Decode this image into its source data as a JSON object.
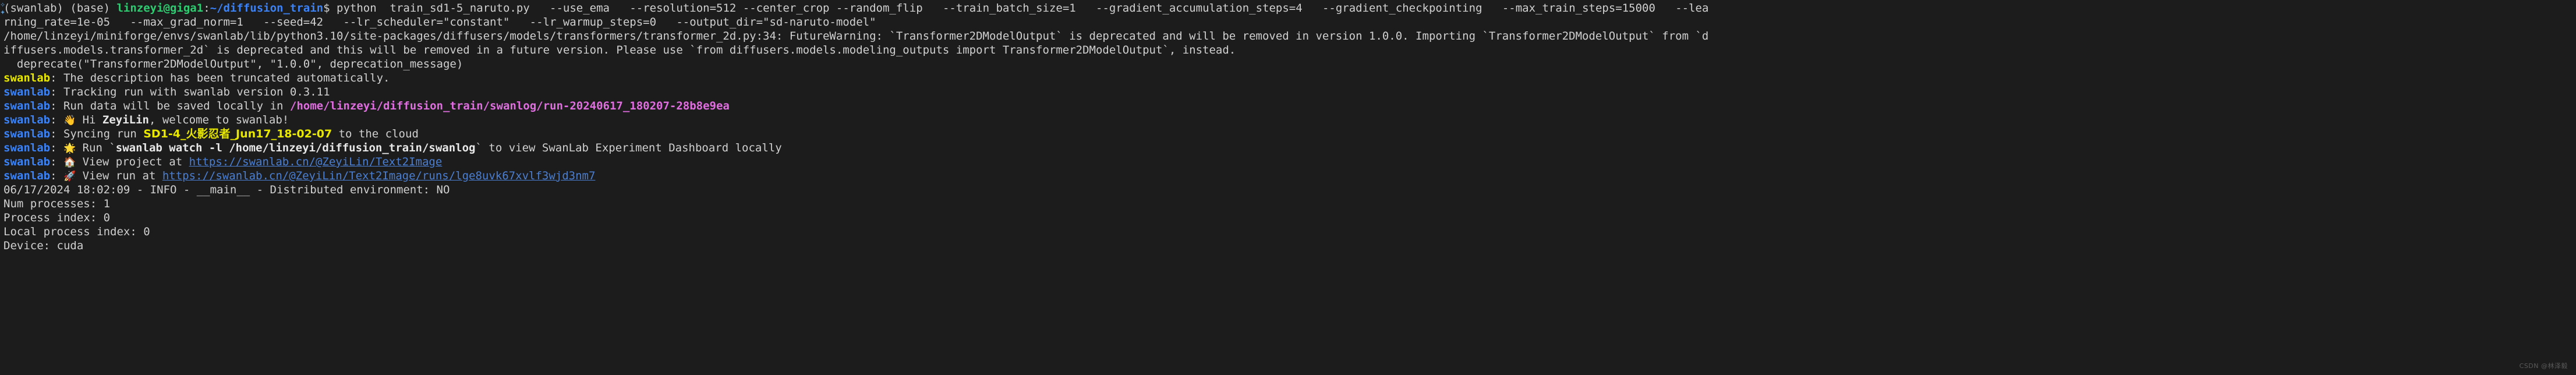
{
  "terminal": {
    "background_color": "#1c1c1c",
    "default_text_color": "#d0d0d0",
    "colors": {
      "prompt_user_host": "#2ecc71",
      "prompt_path": "#3b82f6",
      "swanlab_yellow": "#e8e800",
      "swanlab_blue": "#3b82f6",
      "magenta_path": "#e06ee0",
      "link": "#4a7fd4",
      "run_name_yellow": "#e8e800"
    },
    "gutter_glyph": "✧",
    "watermark": "CSDN @林泽毅"
  },
  "lines": {
    "l1_env1": "(swanlab) ",
    "l1_env2": "(base) ",
    "l1_userhost": "linzeyi@giga1",
    "l1_colon": ":",
    "l1_path": "~/diffusion_train",
    "l1_dollar": "$ ",
    "l1_command": "python  train_sd1-5_naruto.py   --use_ema   --resolution=512 --center_crop --random_flip   --train_batch_size=1   --gradient_accumulation_steps=4   --gradient_checkpointing   --max_train_steps=15000   --lea",
    "l2": "rning_rate=1e-05   --max_grad_norm=1   --seed=42   --lr_scheduler=\"constant\"   --lr_warmup_steps=0   --output_dir=\"sd-naruto-model\"",
    "l3": "/home/linzeyi/miniforge/envs/swanlab/lib/python3.10/site-packages/diffusers/models/transformers/transformer_2d.py:34: FutureWarning: `Transformer2DModelOutput` is deprecated and will be removed in version 1.0.0. Importing `Transformer2DModelOutput` from `d",
    "l4": "iffusers.models.transformer_2d` is deprecated and this will be removed in a future version. Please use `from diffusers.models.modeling_outputs import Transformer2DModelOutput`, instead.",
    "l5": "  deprecate(\"Transformer2DModelOutput\", \"1.0.0\", deprecation_message)",
    "l6_tag": "swanlab",
    "l6_text": ": The description has been truncated automatically.",
    "l7_tag": "swanlab",
    "l7_text": ": Tracking run with swanlab version 0.3.11",
    "l8_tag": "swanlab",
    "l8_pre": ": Run data will be saved locally in ",
    "l8_path": "/home/linzeyi/diffusion_train/swanlog/run-20240617_180207-28b8e9ea",
    "l9_tag": "swanlab",
    "l9_emoji": "👋",
    "l9_pre": " Hi ",
    "l9_user": "ZeyiLin",
    "l9_post": ", welcome to swanlab!",
    "l10_tag": "swanlab",
    "l10_pre": ": Syncing run ",
    "l10_run": "SD1-4_火影忍者_Jun17_18-02-07",
    "l10_post": " to the cloud",
    "l11_tag": "swanlab",
    "l11_emoji": "🌟",
    "l11_pre": " Run `",
    "l11_cmd": "swanlab watch -l /home/linzeyi/diffusion_train/swanlog",
    "l11_post": "` to view SwanLab Experiment Dashboard locally",
    "l12_tag": "swanlab",
    "l12_emoji": "🏠",
    "l12_pre": " View project at ",
    "l12_url": "https://swanlab.cn/@ZeyiLin/Text2Image",
    "l13_tag": "swanlab",
    "l13_emoji": "🚀",
    "l13_pre": " View run at ",
    "l13_url": "https://swanlab.cn/@ZeyiLin/Text2Image/runs/lge8uvk67xvlf3wjd3nm7",
    "l14": "06/17/2024 18:02:09 - INFO - __main__ - Distributed environment: NO",
    "l15": "Num processes: 1",
    "l16": "Process index: 0",
    "l17": "Local process index: 0",
    "l18": "Device: cuda"
  }
}
